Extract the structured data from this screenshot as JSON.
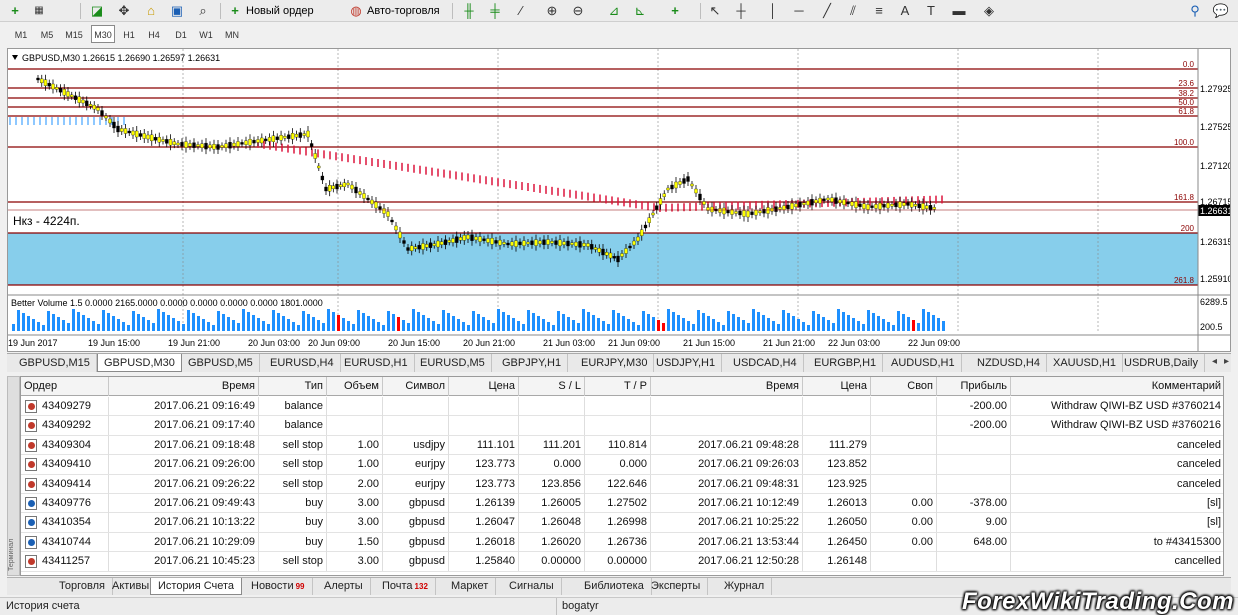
{
  "toolbar": {
    "new_order": "Новый ордер",
    "auto_trading": "Авто-торговля"
  },
  "timeframes": [
    "M1",
    "M5",
    "M15",
    "M30",
    "H1",
    "H4",
    "D1",
    "W1",
    "MN"
  ],
  "active_timeframe": "M30",
  "chart": {
    "info": "GBPUSD,M30  1.26615 1.26690 1.26597 1.26631",
    "annotation": "Нкз - 4224п.",
    "current_price": "1.26631",
    "price_ticks": [
      "1.27925",
      "1.27525",
      "1.27120",
      "1.26715",
      "1.26315",
      "1.25910"
    ],
    "time_ticks": [
      "19 Jun 2017",
      "19 Jun 15:00",
      "19 Jun 21:00",
      "20 Jun 03:00",
      "20 Jun 09:00",
      "20 Jun 15:00",
      "20 Jun 21:00",
      "21 Jun 03:00",
      "21 Jun 09:00",
      "21 Jun 15:00",
      "21 Jun 21:00",
      "22 Jun 03:00",
      "22 Jun 09:00"
    ],
    "fib_levels": [
      "0.0",
      "23.6",
      "38.2",
      "50.0",
      "61.8",
      "100.0",
      "161.8",
      "200",
      "261.8"
    ],
    "indicator_label": "Better Volume 1.5 0.0000 2165.0000 0.0000 0.0000 0.0000 0.0000 1801.0000",
    "volume_ticks": [
      "6289.5",
      "200.5"
    ],
    "colors": {
      "zone": "#87ceeb",
      "fib_line": "#8b0000",
      "bull": "#ffff00",
      "bear": "#000000",
      "volume": "#1e90ff",
      "volume_spike": "#ff0000",
      "ma_red": "#dc143c",
      "ma_blue": "#1e90ff"
    }
  },
  "chart_tabs": [
    "GBPUSD,M15",
    "GBPUSD,M30",
    "GBPUSD,M5",
    "EURUSD,H4",
    "EURUSD,H1",
    "EURUSD,M5",
    "GBPJPY,H1",
    "EURJPY,M30",
    "USDJPY,H1",
    "USDCAD,H4",
    "EURGBP,H1",
    "AUDUSD,H1",
    "NZDUSD,H4",
    "XAUUSD,H1",
    "USDRUB,Daily"
  ],
  "active_chart_tab": "GBPUSD,M30",
  "table": {
    "headers": [
      "Ордер",
      "Время",
      "Тип",
      "Объем",
      "Символ",
      "Цена",
      "S / L",
      "T / P",
      "Время",
      "Цена",
      "Своп",
      "Прибыль",
      "Комментарий"
    ],
    "rows": [
      {
        "icon": "balance",
        "order": "43409279",
        "time": "2017.06.21 09:16:49",
        "type": "balance",
        "volume": "",
        "symbol": "",
        "price": "",
        "sl": "",
        "tp": "",
        "close_time": "",
        "close_price": "",
        "swap": "",
        "profit": "-200.00",
        "comment": "Withdraw QIWI-BZ USD #3760214"
      },
      {
        "icon": "balance",
        "order": "43409292",
        "time": "2017.06.21 09:17:40",
        "type": "balance",
        "volume": "",
        "symbol": "",
        "price": "",
        "sl": "",
        "tp": "",
        "close_time": "",
        "close_price": "",
        "swap": "",
        "profit": "-200.00",
        "comment": "Withdraw QIWI-BZ USD #3760216"
      },
      {
        "icon": "sell",
        "order": "43409304",
        "time": "2017.06.21 09:18:48",
        "type": "sell stop",
        "volume": "1.00",
        "symbol": "usdjpy",
        "price": "111.101",
        "sl": "111.201",
        "tp": "110.814",
        "close_time": "2017.06.21 09:48:28",
        "close_price": "111.279",
        "swap": "",
        "profit": "",
        "comment": "canceled"
      },
      {
        "icon": "sell",
        "order": "43409410",
        "time": "2017.06.21 09:26:00",
        "type": "sell stop",
        "volume": "1.00",
        "symbol": "eurjpy",
        "price": "123.773",
        "sl": "0.000",
        "tp": "0.000",
        "close_time": "2017.06.21 09:26:03",
        "close_price": "123.852",
        "swap": "",
        "profit": "",
        "comment": "canceled"
      },
      {
        "icon": "sell",
        "order": "43409414",
        "time": "2017.06.21 09:26:22",
        "type": "sell stop",
        "volume": "2.00",
        "symbol": "eurjpy",
        "price": "123.773",
        "sl": "123.856",
        "tp": "122.646",
        "close_time": "2017.06.21 09:48:31",
        "close_price": "123.925",
        "swap": "",
        "profit": "",
        "comment": "canceled"
      },
      {
        "icon": "buy",
        "order": "43409776",
        "time": "2017.06.21 09:49:43",
        "type": "buy",
        "volume": "3.00",
        "symbol": "gbpusd",
        "price": "1.26139",
        "sl": "1.26005",
        "tp": "1.27502",
        "close_time": "2017.06.21 10:12:49",
        "close_price": "1.26013",
        "swap": "0.00",
        "profit": "-378.00",
        "comment": "[sl]"
      },
      {
        "icon": "buy",
        "order": "43410354",
        "time": "2017.06.21 10:13:22",
        "type": "buy",
        "volume": "3.00",
        "symbol": "gbpusd",
        "price": "1.26047",
        "sl": "1.26048",
        "tp": "1.26998",
        "close_time": "2017.06.21 10:25:22",
        "close_price": "1.26050",
        "swap": "0.00",
        "profit": "9.00",
        "comment": "[sl]"
      },
      {
        "icon": "buy",
        "order": "43410744",
        "time": "2017.06.21 10:29:09",
        "type": "buy",
        "volume": "1.50",
        "symbol": "gbpusd",
        "price": "1.26018",
        "sl": "1.26020",
        "tp": "1.26736",
        "close_time": "2017.06.21 13:53:44",
        "close_price": "1.26450",
        "swap": "0.00",
        "profit": "648.00",
        "comment": "to #43415300"
      },
      {
        "icon": "sell",
        "order": "43411257",
        "time": "2017.06.21 10:45:23",
        "type": "sell stop",
        "volume": "3.00",
        "symbol": "gbpusd",
        "price": "1.25840",
        "sl": "0.00000",
        "tp": "0.00000",
        "close_time": "2017.06.21 12:50:28",
        "close_price": "1.26148",
        "swap": "",
        "profit": "",
        "comment": "cancelled"
      }
    ]
  },
  "side_label": "Терминал",
  "bottom_tabs": [
    {
      "label": "Торговля"
    },
    {
      "label": "Активы"
    },
    {
      "label": "История Счета"
    },
    {
      "label": "Новости",
      "badge": "99"
    },
    {
      "label": "Алерты"
    },
    {
      "label": "Почта",
      "badge": "132"
    },
    {
      "label": "Маркет"
    },
    {
      "label": "Сигналы"
    },
    {
      "label": "Библиотека"
    },
    {
      "label": "Эксперты"
    },
    {
      "label": "Журнал"
    }
  ],
  "active_bottom_tab": "История Счета",
  "status": {
    "left": "История счета",
    "user": "bogatyr"
  },
  "watermark": "ForexWikiTrading.Com"
}
